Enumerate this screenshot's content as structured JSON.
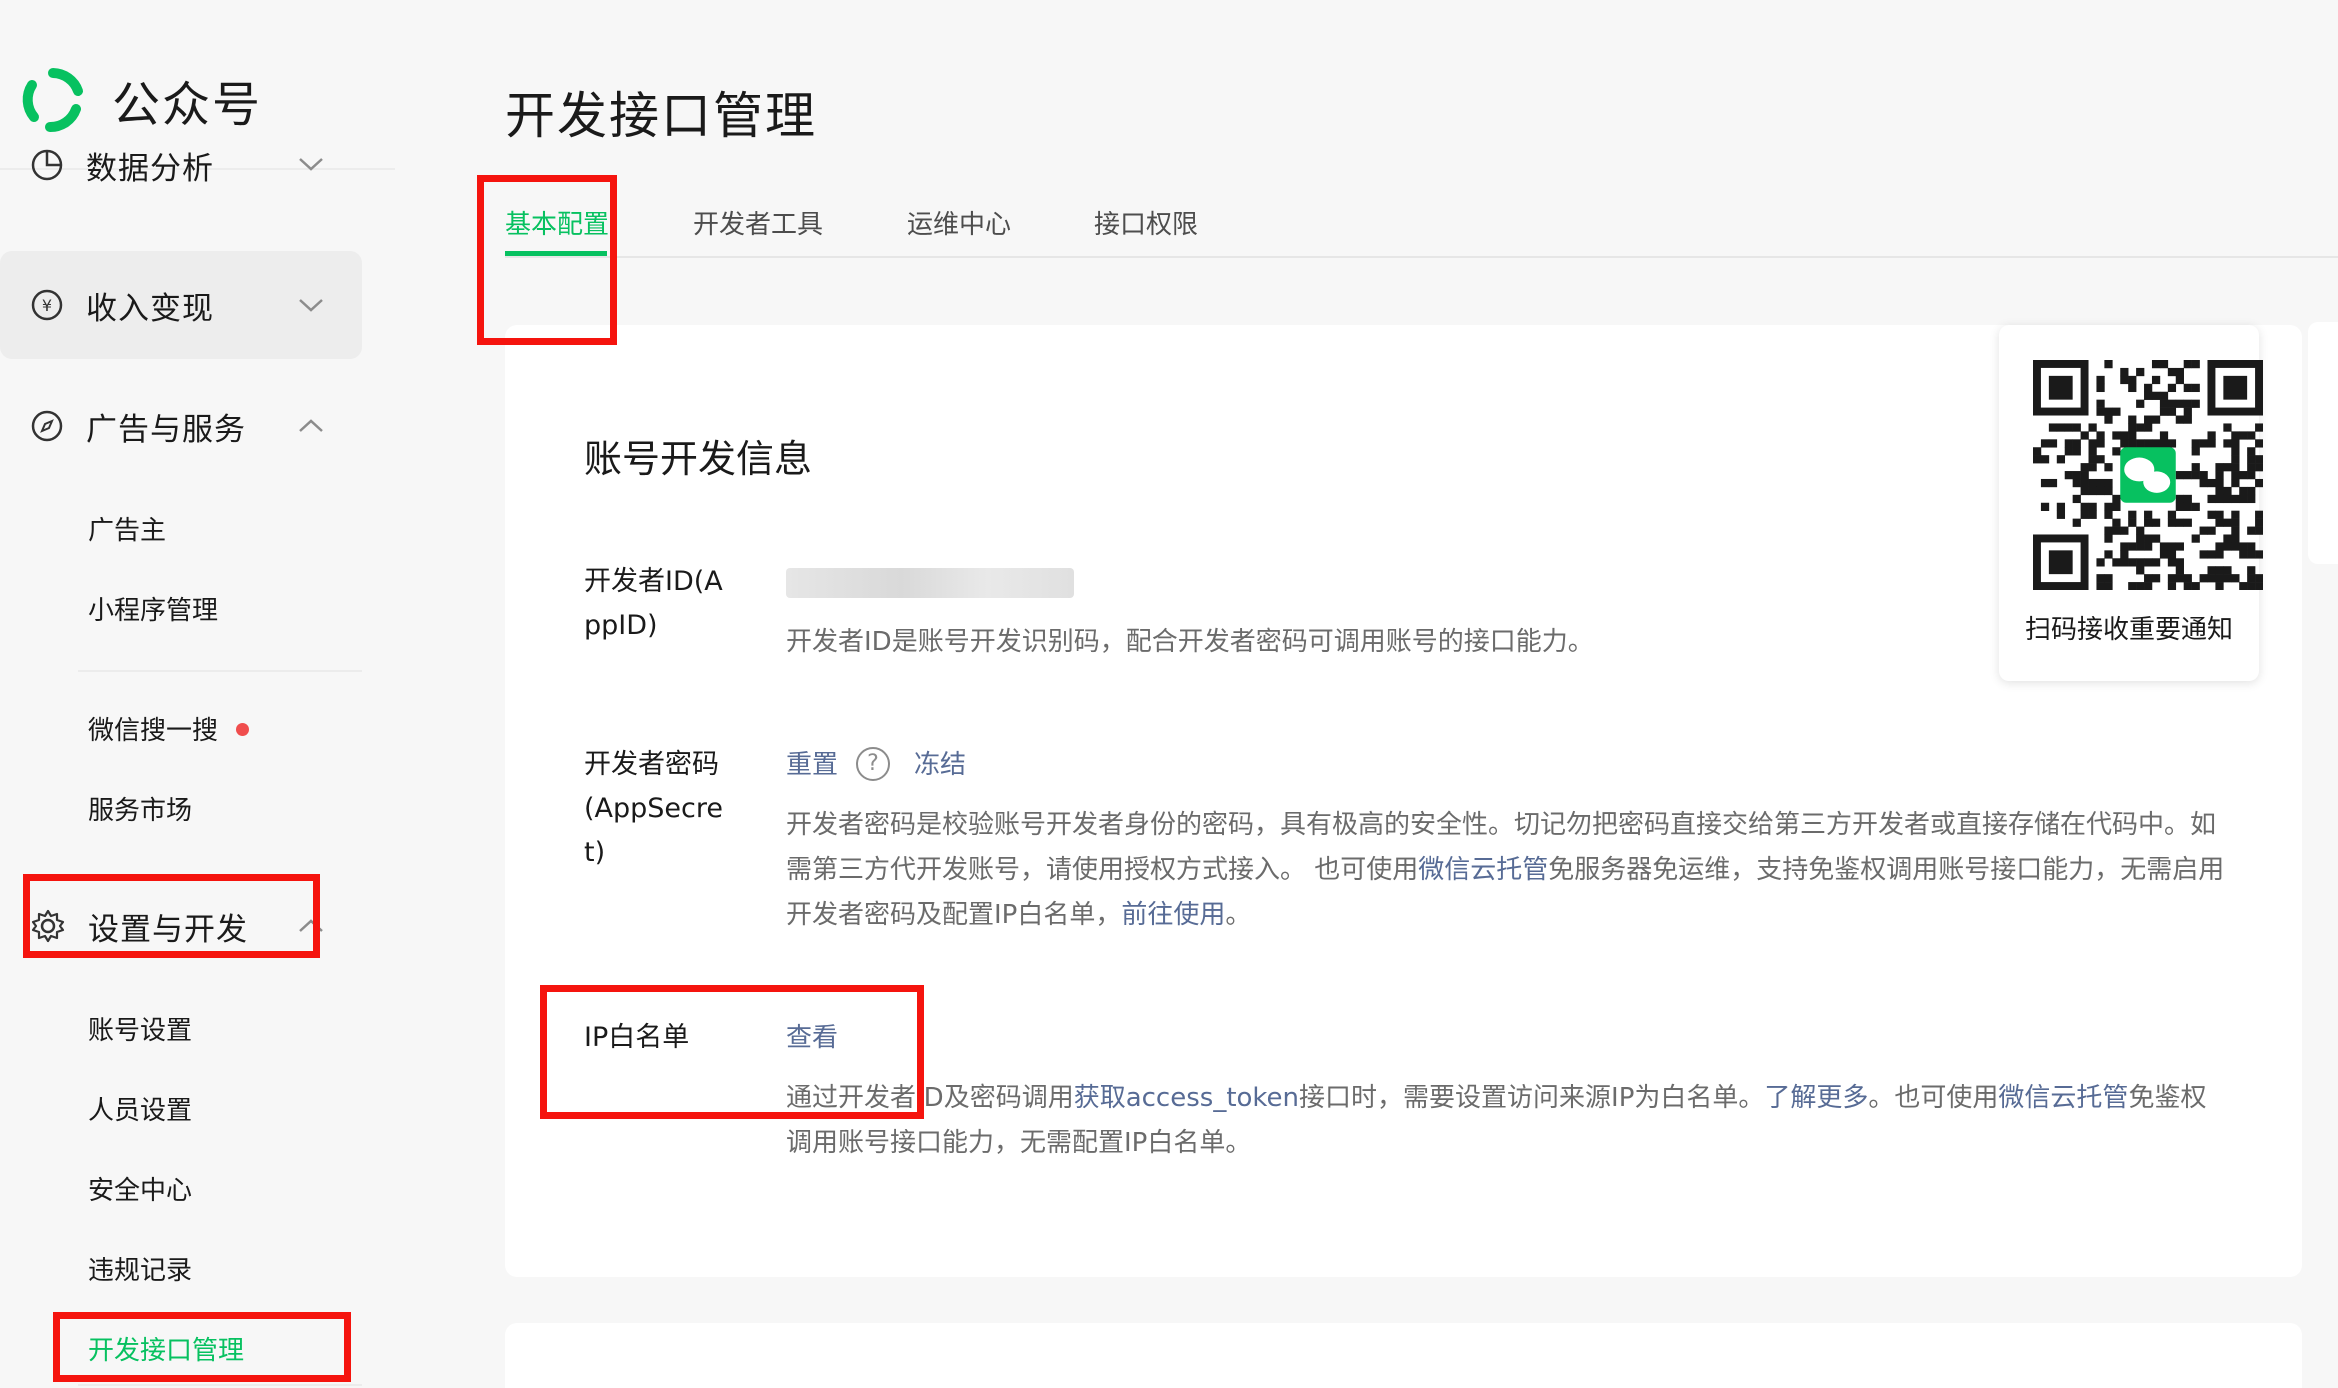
{
  "app": {
    "title": "公众号"
  },
  "sidebar": {
    "groups": [
      {
        "label": "数据分析",
        "icon": "pie-chart-icon",
        "chevron": "down"
      },
      {
        "label": "收入变现",
        "icon": "yen-circle-icon",
        "chevron": "down"
      },
      {
        "label": "广告与服务",
        "icon": "compass-icon",
        "chevron": "up"
      },
      {
        "label": "设置与开发",
        "icon": "gear-icon",
        "chevron": "up"
      }
    ],
    "ad_items": [
      "广告主",
      "小程序管理"
    ],
    "service_items": [
      "微信搜一搜",
      "服务市场"
    ],
    "settings_items": [
      "账号设置",
      "人员设置",
      "安全中心",
      "违规记录",
      "开发接口管理"
    ]
  },
  "main": {
    "page_title": "开发接口管理",
    "tabs": [
      {
        "label": "基本配置",
        "active": true
      },
      {
        "label": "开发者工具",
        "active": false
      },
      {
        "label": "运维中心",
        "active": false
      },
      {
        "label": "接口权限",
        "active": false
      }
    ],
    "section_title": "账号开发信息",
    "appid": {
      "label_line1": "开发者ID(A",
      "label_line2": "ppID)",
      "desc": "开发者ID是账号开发识别码，配合开发者密码可调用账号的接口能力。"
    },
    "secret": {
      "label_line1": "开发者密码",
      "label_line2": "(AppSecre",
      "label_line3": "t)",
      "reset": "重置",
      "help": "?",
      "freeze": "冻结",
      "desc_part1": "开发者密码是校验账号开发者身份的密码，具有极高的安全性。切记勿把密码直接交给第三方开发者或直接存储在代码中。如需第三方代开发账号，请使用授权方式接入。 也可使用",
      "cloud_link": "微信云托管",
      "desc_part2": "免服务器免运维，支持免鉴权调用账号接口能力，无需启用开发者密码及配置IP白名单，",
      "go_link": "前往使用",
      "desc_part3": "。"
    },
    "ip": {
      "label": "IP白名单",
      "view": "查看",
      "desc_part1": "通过开发者ID及密码调用",
      "token_link": "获取access_token",
      "desc_part2": "接口时，需要设置访问来源IP为白名单。",
      "more_link": "了解更多",
      "desc_part3": "。也可使用",
      "cloud_link": "微信云托管",
      "desc_part4": "免鉴权调用账号接口能力，无需配置IP白名单。"
    }
  },
  "qr": {
    "caption": "扫码接收重要通知"
  },
  "colors": {
    "accent": "#07c160",
    "link": "#576b95",
    "annotation": "#f5140e"
  }
}
